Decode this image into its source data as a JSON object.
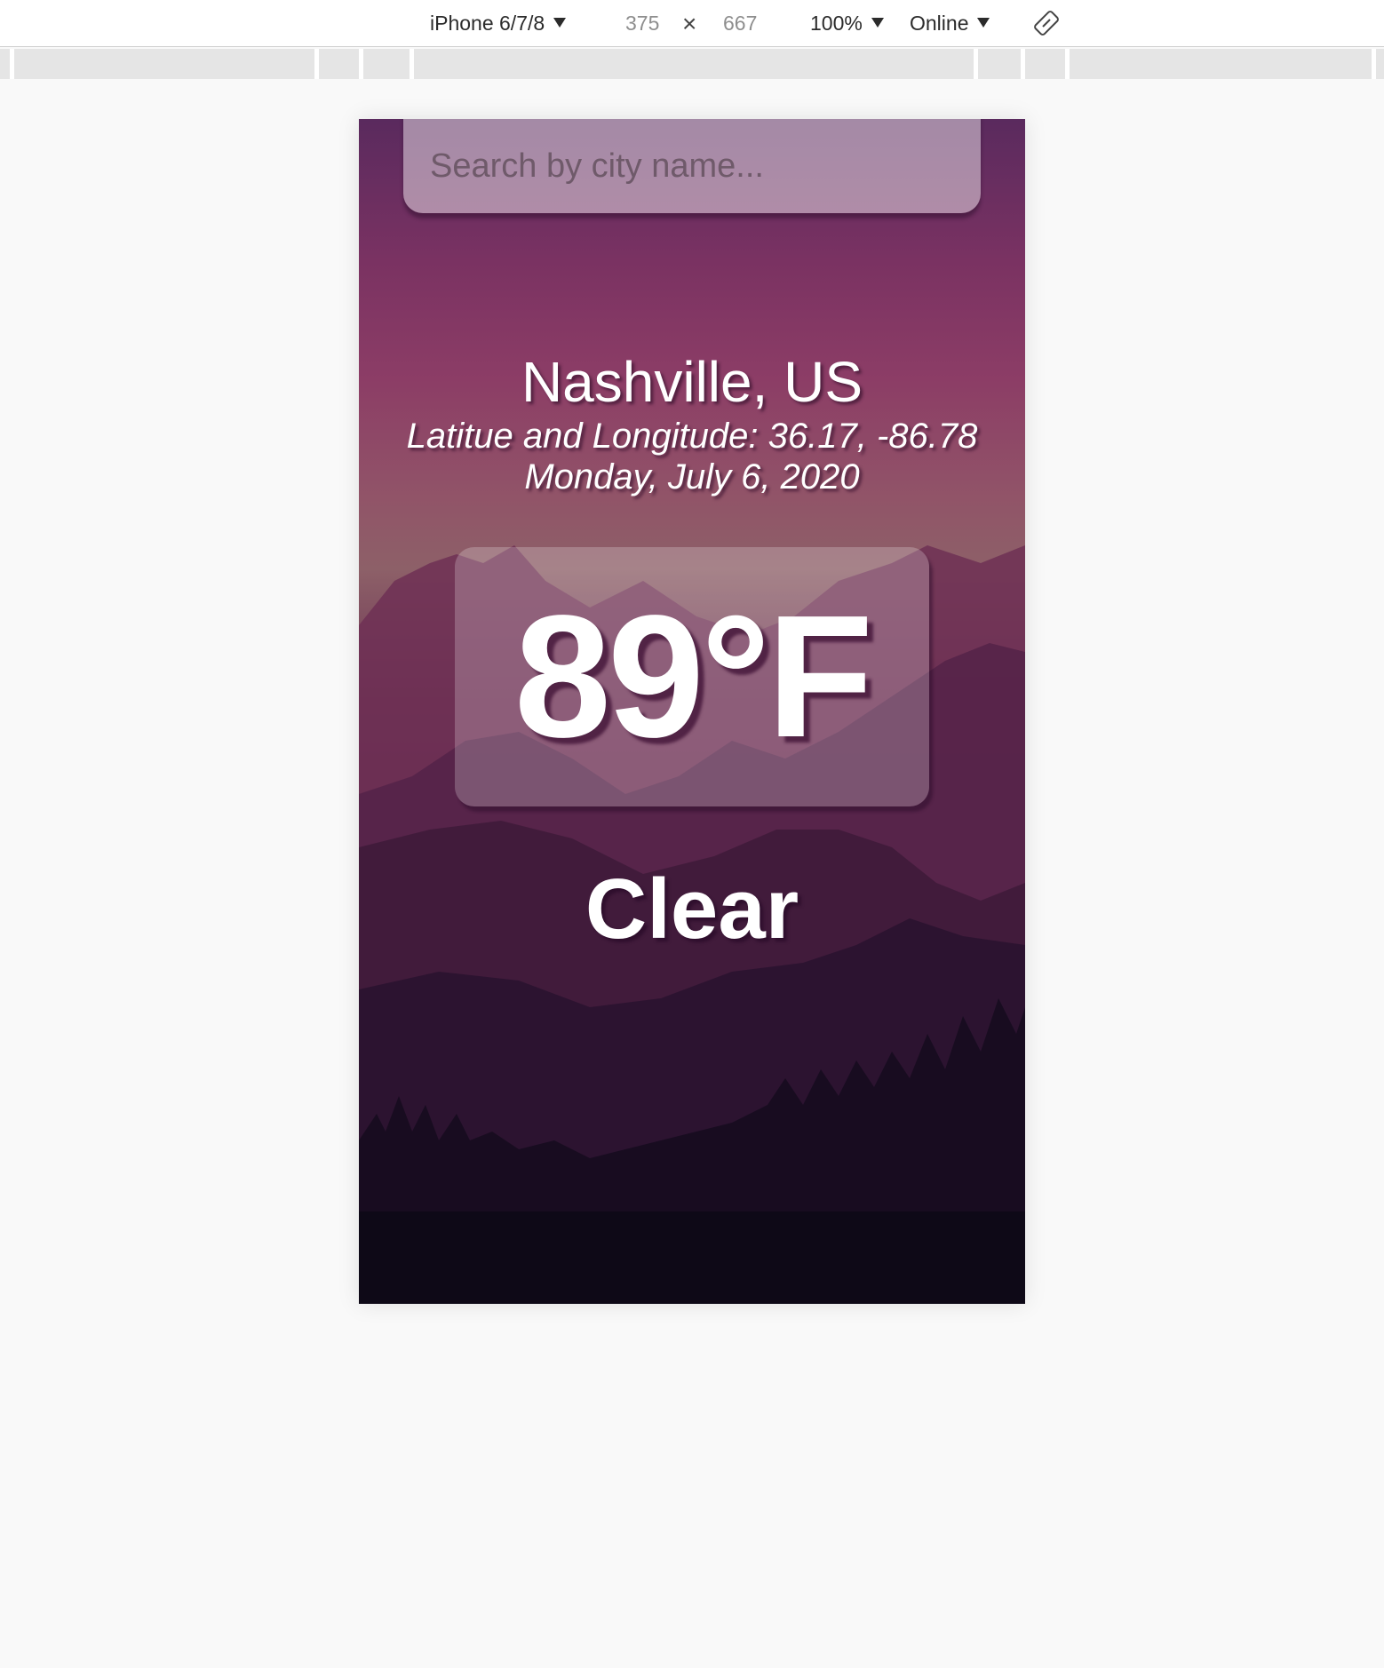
{
  "devtools": {
    "device": "iPhone 6/7/8",
    "width": "375",
    "times": "×",
    "height": "667",
    "zoom": "100%",
    "network": "Online",
    "rotate_icon": "rotate-icon"
  },
  "app": {
    "search": {
      "placeholder": "Search by city name..."
    },
    "location": {
      "city": "Nashville, US",
      "coords": "Latitue and Longitude: 36.17, -86.78",
      "date": "Monday, July 6, 2020"
    },
    "temperature": "89°F",
    "weather": "Clear"
  },
  "colors": {
    "page_bg": "#f9f9f9",
    "sky_top": "#5a2a5e",
    "sky_mid": "#915468",
    "ground": "#0a0914",
    "text": "#ffffff"
  }
}
